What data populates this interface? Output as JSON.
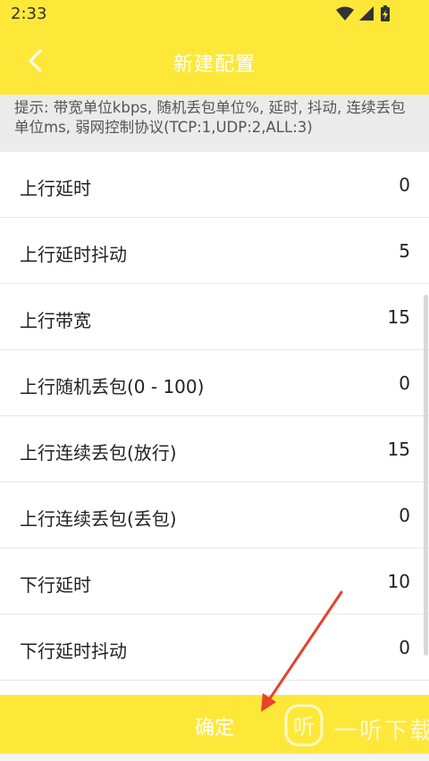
{
  "status_bar": {
    "time": "2:33",
    "icons": [
      "wifi-icon",
      "signal-icon",
      "battery-charging-icon"
    ]
  },
  "app_bar": {
    "back_icon": "chevron-left-icon",
    "title": "新建配置"
  },
  "hint": {
    "text": "提示: 带宽单位kbps, 随机丢包单位%, 延时, 抖动, 连续丢包单位ms, 弱网控制协议(TCP:1,UDP:2,ALL:3)"
  },
  "settings": [
    {
      "label": "上行延时",
      "value": "0"
    },
    {
      "label": "上行延时抖动",
      "value": "5"
    },
    {
      "label": "上行带宽",
      "value": "15"
    },
    {
      "label": "上行随机丢包(0 - 100)",
      "value": "0"
    },
    {
      "label": "上行连续丢包(放行)",
      "value": "15"
    },
    {
      "label": "上行连续丢包(丢包)",
      "value": "0"
    },
    {
      "label": "下行延时",
      "value": "10"
    },
    {
      "label": "下行延时抖动",
      "value": "0"
    }
  ],
  "confirm": {
    "label": "确定"
  },
  "watermark": {
    "text": "一听下载",
    "icon": "ting-logo-icon"
  },
  "colors": {
    "accent": "#fde83a",
    "hint_bg": "#ebebeb",
    "annotation_arrow": "#e8412c"
  }
}
